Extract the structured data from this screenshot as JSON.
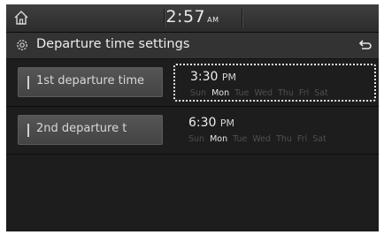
{
  "status_bar": {
    "clock": "2:57",
    "clock_ampm": "AM"
  },
  "header": {
    "title": "Departure time settings"
  },
  "departures": [
    {
      "button_label": "1st departure time",
      "time": "3:30",
      "ampm": "PM",
      "selected": true,
      "days": [
        "Sun",
        "Mon",
        "Tue",
        "Wed",
        "Thu",
        "Fri",
        "Sat"
      ],
      "active_days": [
        false,
        true,
        false,
        false,
        false,
        false,
        false
      ]
    },
    {
      "button_label": "2nd departure t",
      "time": "6:30",
      "ampm": "PM",
      "selected": false,
      "days": [
        "Sun",
        "Mon",
        "Tue",
        "Wed",
        "Thu",
        "Fri",
        "Sat"
      ],
      "active_days": [
        false,
        true,
        false,
        false,
        false,
        false,
        false
      ]
    }
  ],
  "icons": {
    "home": "home-icon",
    "settings": "gear-icon",
    "back": "back-icon"
  },
  "colors": {
    "background": "#1d1d1d",
    "active_day": "#e8e8e8",
    "inactive_day": "#4f4f4f"
  }
}
